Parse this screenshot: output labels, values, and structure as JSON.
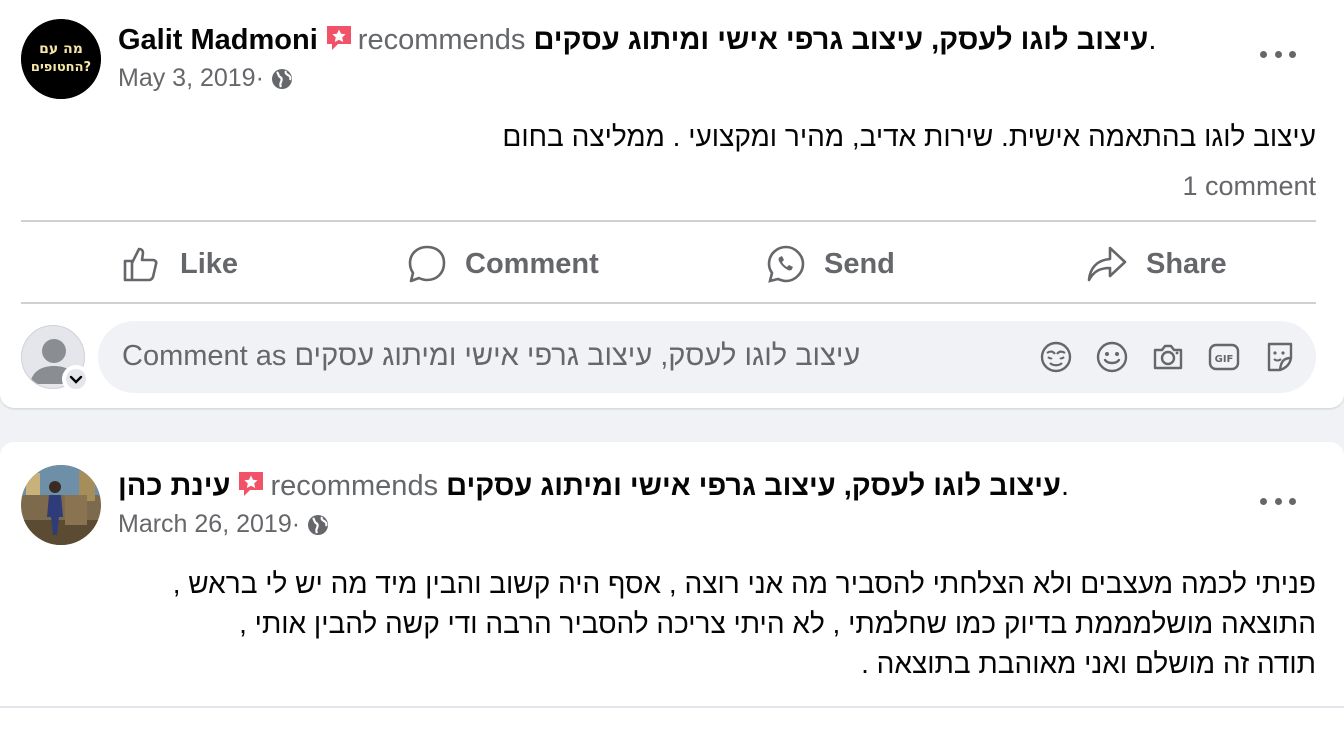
{
  "posts": [
    {
      "author": "Galit Madmoni",
      "avatar_text": [
        "מה עם",
        "החטופים?"
      ],
      "recommends": "recommends",
      "page": "עיצוב לוגו לעסק, עיצוב גרפי אישי ומיתוג עסקים",
      "page_suffix": ".",
      "date": "May 3, 2019",
      "date_sep": "·",
      "text_lines": [
        "עיצוב לוגו בהתאמה אישית. שירות אדיב, מהיר ומקצועי . ממליצה בחום"
      ],
      "comment_count": "1 comment"
    },
    {
      "author": "עינת כהן",
      "recommends": "recommends",
      "page": "עיצוב לוגו לעסק, עיצוב גרפי אישי ומיתוג עסקים",
      "page_suffix": ".",
      "date": "March 26, 2019",
      "date_sep": "·",
      "text_lines": [
        "פניתי לכמה מעצבים ולא הצלחתי להסביר מה אני רוצה , אסף היה קשוב והבין מיד מה יש לי בראש ,",
        "התוצאה מושלמממת בדיוק כמו שחלמתי , לא היתי צריכה להסביר הרבה ודי קשה להבין אותי ,",
        "תודה זה מושלם ואני מאוהבת בתוצאה ."
      ]
    }
  ],
  "actions": {
    "like": "Like",
    "comment": "Comment",
    "send": "Send",
    "share": "Share"
  },
  "comment_box": {
    "placeholder": "Comment as עיצוב לוגו לעסק, עיצוב גרפי אישי ומיתוג עסקים"
  },
  "colors": {
    "secondary_text": "#65676b",
    "badge": "#f25268",
    "divider": "#ced0d4"
  },
  "icons": [
    "more-options-icon",
    "globe-icon",
    "recommend-badge-icon",
    "like-icon",
    "comment-icon",
    "send-icon",
    "share-icon",
    "avatar-icon",
    "chevron-down-icon",
    "avatar-sticker-icon",
    "emoji-icon",
    "camera-icon",
    "gif-icon",
    "sticker-icon"
  ]
}
